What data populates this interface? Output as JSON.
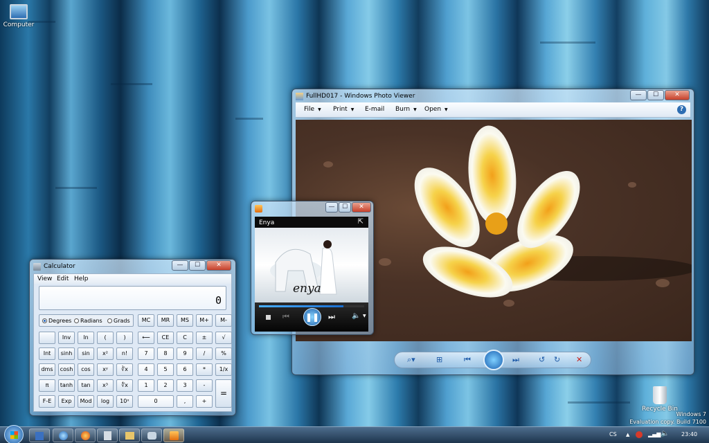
{
  "desktop": {
    "computer_label": "Computer",
    "recycle_label": "Recycle Bin",
    "watermark_line1": "Windows 7",
    "watermark_line2": "Evaluation copy. Build 7100"
  },
  "photo_viewer": {
    "title": "FullHD017 - Windows Photo Viewer",
    "menu": [
      "File",
      "Print",
      "E-mail",
      "Burn",
      "Open"
    ],
    "help": "?"
  },
  "media_player": {
    "title": "Enya",
    "artist_logo": "enya"
  },
  "calculator": {
    "title": "Calculator",
    "menu": [
      "View",
      "Edit",
      "Help"
    ],
    "display": "0",
    "modes": [
      "Degrees",
      "Radians",
      "Grads"
    ],
    "rows": [
      [
        "",
        "Inv",
        "ln",
        "(",
        ")",
        "⟵",
        "CE",
        "C",
        "±",
        "√"
      ],
      [
        "Int",
        "sinh",
        "sin",
        "x²",
        "n!",
        "7",
        "8",
        "9",
        "/",
        "%"
      ],
      [
        "dms",
        "cosh",
        "cos",
        "xʸ",
        "∛x",
        "4",
        "5",
        "6",
        "*",
        "1/x"
      ],
      [
        "π",
        "tanh",
        "tan",
        "x³",
        "∜x",
        "1",
        "2",
        "3",
        "-",
        "="
      ],
      [
        "F-E",
        "Exp",
        "Mod",
        "log",
        "10ˣ",
        "0",
        ",",
        "+"
      ]
    ],
    "mem": [
      "MC",
      "MR",
      "MS",
      "M+",
      "M-"
    ]
  },
  "window_controls": {
    "minimize": "—",
    "maximize": "☐",
    "close": "✕"
  },
  "tray": {
    "lang": "CS",
    "time": "23:40"
  }
}
